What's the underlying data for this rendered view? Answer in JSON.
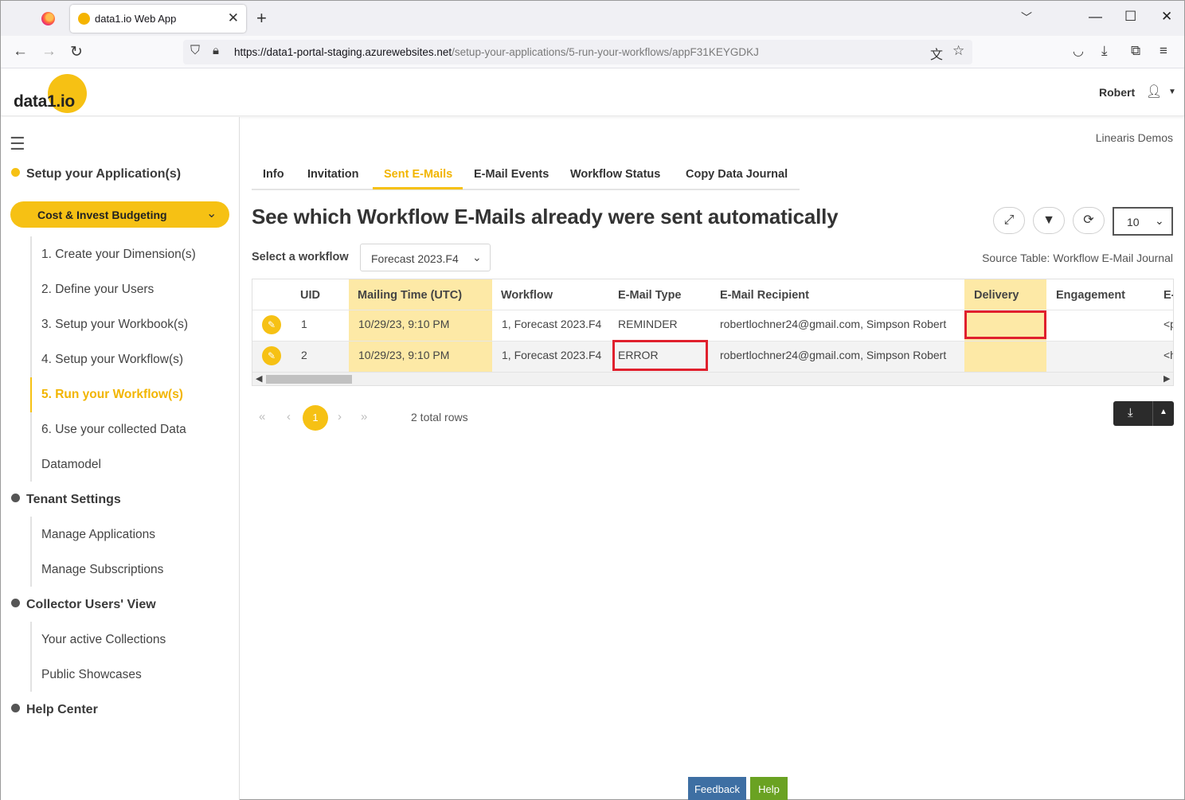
{
  "browser": {
    "tab_title": "data1.io Web App",
    "url_domain": "https://data1-portal-staging.azurewebsites.net",
    "url_path": "/setup-your-applications/5-run-your-workflows/appF31KEYGDKJ"
  },
  "header": {
    "logo": "data1.io",
    "user_name": "Robert"
  },
  "sidebar": {
    "sections": {
      "setup": "Setup your Application(s)",
      "tenant": "Tenant Settings",
      "collector": "Collector Users' View",
      "help": "Help Center"
    },
    "selected_app": "Cost & Invest Budgeting",
    "setup_items": [
      "1. Create your Dimension(s)",
      "2. Define your Users",
      "3. Setup your Workbook(s)",
      "4. Setup your Workflow(s)",
      "5. Run your Workflow(s)",
      "6. Use your collected Data",
      "Datamodel"
    ],
    "tenant_items": [
      "Manage Applications",
      "Manage Subscriptions"
    ],
    "collector_items": [
      "Your active Collections",
      "Public Showcases"
    ]
  },
  "main": {
    "tenant_name": "Linearis Demos",
    "tabs": [
      "Info",
      "Invitation",
      "Sent E-Mails",
      "E-Mail Events",
      "Workflow Status",
      "Copy Data Journal"
    ],
    "active_tab": "Sent E-Mails",
    "heading": "See which Workflow E-Mails already were sent automatically",
    "page_size": "10",
    "workflow_label": "Select a workflow",
    "workflow_value": "Forecast 2023.F4",
    "source_table": "Source Table: Workflow E-Mail Journal"
  },
  "table": {
    "columns": [
      "UID",
      "Mailing Time (UTC)",
      "Workflow",
      "E-Mail Type",
      "E-Mail Recipient",
      "Delivery",
      "Engagement",
      "E-"
    ],
    "rows": [
      {
        "uid": "1",
        "time": "10/29/23, 9:10 PM",
        "workflow": "1, Forecast 2023.F4",
        "type": "REMINDER",
        "recipient": "robertlochner24@gmail.com, Simpson Robert",
        "delivery": "",
        "engagement": "",
        "extra": "<p"
      },
      {
        "uid": "2",
        "time": "10/29/23, 9:10 PM",
        "workflow": "1, Forecast 2023.F4",
        "type": "ERROR",
        "recipient": "robertlochner24@gmail.com, Simpson Robert",
        "delivery": "",
        "engagement": "",
        "extra": "<h"
      }
    ]
  },
  "pagination": {
    "current_page": "1",
    "total_rows": "2 total rows"
  },
  "footer": {
    "feedback": "Feedback",
    "help": "Help"
  },
  "colors": {
    "accent": "#f6c114",
    "highlight": "#e0202d"
  }
}
